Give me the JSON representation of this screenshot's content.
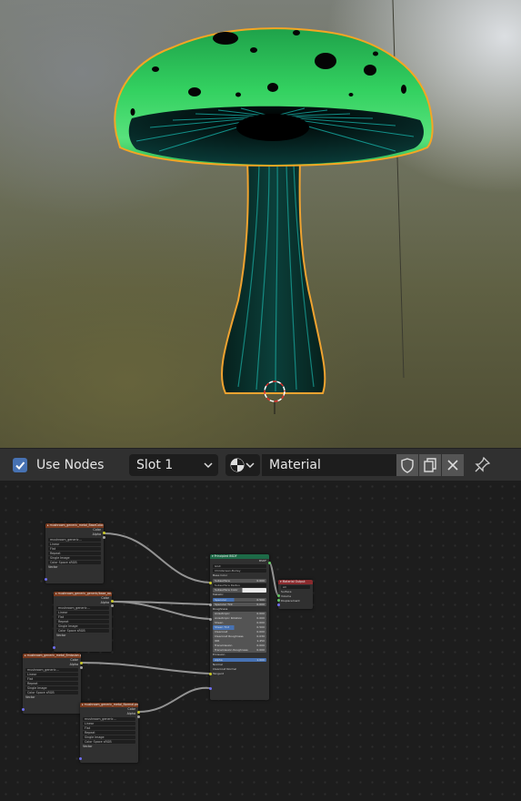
{
  "header": {
    "use_nodes_label": "Use Nodes",
    "use_nodes_checked": true,
    "slot_label": "Slot 1",
    "material_name": "Material"
  },
  "icons": [
    "checkbox-icon",
    "chevron-down-icon",
    "sphere-material-icon",
    "shield-fake-user-icon",
    "duplicate-icon",
    "close-icon",
    "pin-icon",
    "3d-cursor-icon"
  ],
  "colors": {
    "accent": "#4772b3",
    "cap_green": "#2ecc5a",
    "outline": "#f5a623"
  },
  "nodes": {
    "tex1": {
      "title": "▸ mushroom_generic_metal_BaseColor.png",
      "outputs": [
        "Color",
        "Alpha"
      ],
      "fields": [
        "mushroom_generic...",
        "Linear",
        "Flat",
        "Repeat",
        "Single Image"
      ],
      "colorspace": "Color Space",
      "colorspace_val": "sRGB",
      "vector": "Vector"
    },
    "tex2": {
      "title": "▸ mushroom_generic_generic/base_ao.png",
      "outputs": [
        "Color",
        "Alpha"
      ],
      "fields": [
        "mushroom_generic...",
        "Linear",
        "Flat",
        "Repeat",
        "Single Image"
      ],
      "colorspace": "Color Space",
      "colorspace_val": "sRGB",
      "vector": "Vector"
    },
    "tex3": {
      "title": "▸ mushroom_generic_metal_Emission.png",
      "outputs": [
        "Color",
        "Alpha"
      ],
      "fields": [
        "mushroom_generic...",
        "Linear",
        "Flat",
        "Repeat",
        "Single Image"
      ],
      "colorspace": "Color Space",
      "colorspace_val": "sRGB",
      "vector": "Vector"
    },
    "tex4": {
      "title": "▸ mushroom_generic_metal_Normal.png",
      "outputs": [
        "Color",
        "Alpha"
      ],
      "fields": [
        "mushroom_generic...",
        "Linear",
        "Flat",
        "Repeat",
        "Single Image"
      ],
      "colorspace": "Color Space",
      "colorspace_val": "sRGB",
      "vector": "Vector"
    },
    "bsdf": {
      "title": "▾ Principled BSDF",
      "output": "BSDF",
      "dist": "GGX",
      "sss": "Christensen-Burley",
      "inputs": [
        "Base Color",
        "Subsurface",
        "Subsurface Radius",
        "Subsurface Color",
        "Metallic",
        "Specular",
        "Specular Tint",
        "Roughness",
        "Anisotropic",
        "Anisotropic Rotation",
        "Sheen",
        "Sheen Tint",
        "Clearcoat",
        "Clearcoat Roughness",
        "IOR",
        "Transmission",
        "Transmission Roughness",
        "Emission",
        "Alpha",
        "Normal",
        "Clearcoat Normal",
        "Tangent"
      ],
      "values": {
        "Subsurface": "0.000",
        "Metallic": "0.000",
        "Specular": "0.500",
        "Specular Tint": "0.000",
        "Anisotropic": "0.000",
        "Anisotropic Rotation": "0.000",
        "Sheen": "0.000",
        "Sheen Tint": "0.500",
        "Clearcoat": "0.000",
        "Clearcoat Roughness": "0.030",
        "IOR": "1.450",
        "Transmission": "0.000",
        "Transmission Roughness": "0.000",
        "Alpha": "1.000"
      }
    },
    "output": {
      "title": "▾ Material Output",
      "target": "All",
      "inputs": [
        "Surface",
        "Volume",
        "Displacement"
      ]
    }
  }
}
